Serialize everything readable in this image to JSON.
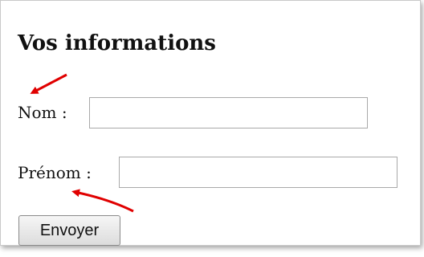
{
  "form": {
    "heading": "Vos informations",
    "fields": [
      {
        "label": "Nom :",
        "value": ""
      },
      {
        "label": "Prénom :",
        "value": ""
      }
    ],
    "submit_label": "Envoyer"
  },
  "annotations": {
    "arrow_color": "#e00000"
  }
}
